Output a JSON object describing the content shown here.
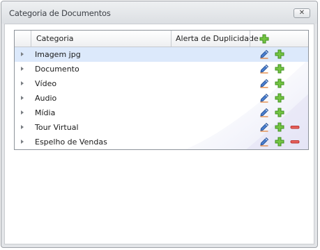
{
  "window": {
    "title": "Categoria de Documentos",
    "close_icon": "close-icon"
  },
  "grid": {
    "columns": {
      "categoria": "Categoria",
      "alerta": "Alerta de Duplicidade"
    },
    "header_action_icon": "plus-icon",
    "rows": [
      {
        "label": "Imagem jpg",
        "selected": true,
        "actions": [
          "edit-icon",
          "plus-icon"
        ]
      },
      {
        "label": "Documento",
        "selected": false,
        "actions": [
          "edit-icon",
          "plus-icon"
        ]
      },
      {
        "label": "Vídeo",
        "selected": false,
        "actions": [
          "edit-icon",
          "plus-icon"
        ]
      },
      {
        "label": "Audio",
        "selected": false,
        "actions": [
          "edit-icon",
          "plus-icon"
        ]
      },
      {
        "label": "Mídia",
        "selected": false,
        "actions": [
          "edit-icon",
          "plus-icon"
        ]
      },
      {
        "label": "Tour Virtual",
        "selected": false,
        "actions": [
          "edit-icon",
          "plus-icon",
          "minus-icon"
        ]
      },
      {
        "label": "Espelho de Vendas",
        "selected": false,
        "actions": [
          "edit-icon",
          "plus-icon",
          "minus-icon"
        ]
      }
    ]
  },
  "colors": {
    "selected_row": "#dce9fb",
    "add_green": "#5cb82e",
    "remove_red": "#e0524d",
    "edit_blue": "#3a6fc4"
  }
}
